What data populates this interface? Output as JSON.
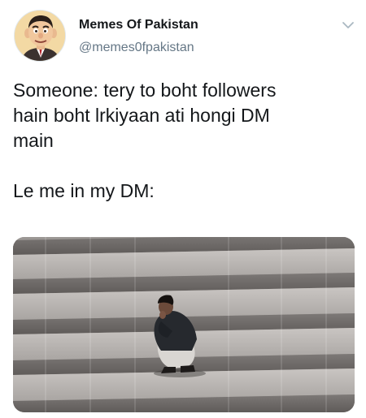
{
  "tweet": {
    "author": {
      "display_name": "Memes Of Pakistan",
      "handle": "@memes0fpakistan",
      "avatar_icon": "cartoon-man-avatar"
    },
    "menu_icon": "chevron-down-icon",
    "text_lines": [
      "Someone: tery to boht followers\nhain boht lrkiyaan ati hongi DM\nmain",
      "Le me in my DM:"
    ],
    "media": {
      "kind": "photo",
      "description_icon": "man-crouching-on-steps-photo"
    }
  },
  "colors": {
    "text_primary": "#14171a",
    "text_secondary": "#657786",
    "chevron": "#aab8c2"
  }
}
